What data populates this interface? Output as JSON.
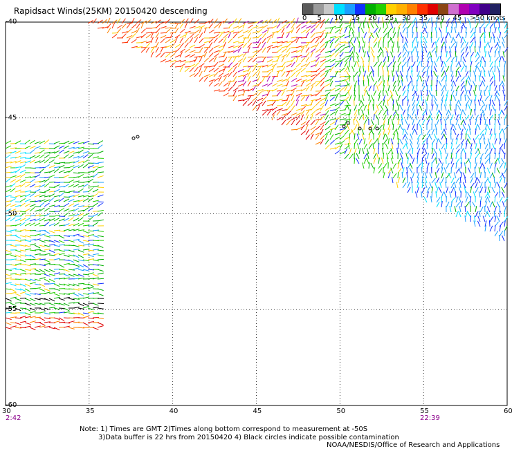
{
  "title": "Rapidsact Winds(25KM) 20150420 descending",
  "legend": {
    "labels": [
      "0",
      "5",
      "10",
      "15",
      "20",
      "25",
      "30",
      "35",
      "40",
      "45",
      ">50 knots"
    ],
    "colors": [
      "#5a5a5a",
      "#9a9a9a",
      "#c8c8c8",
      "#00e0ff",
      "#1a9fff",
      "#1030ff",
      "#00b000",
      "#22d000",
      "#ffd000",
      "#ffb000",
      "#ff8000",
      "#ff3000",
      "#e00000",
      "#8b4513",
      "#d070d0",
      "#b000b0",
      "#8000c0",
      "#40008a",
      "#202060"
    ]
  },
  "map": {
    "lon_range": [
      30,
      60
    ],
    "lat_range": [
      -60,
      -40
    ],
    "lon_ticks": [
      "30",
      "35",
      "40",
      "45",
      "50",
      "55",
      "60"
    ],
    "lat_ticks": [
      "-40",
      "-45",
      "-50",
      "-55",
      "-60"
    ],
    "grid": "dotted"
  },
  "times": {
    "left": "2:42",
    "right": "22:39"
  },
  "notes": {
    "line1": "Note: 1) Times are GMT 2)Times along bottom correspond to measurement at -50S",
    "line2": "3)Data buffer is 22 hrs from 20150420 4) Black circles indicate possible contamination",
    "line3": "NOAA/NESDIS/Office of Research and Applications"
  }
}
